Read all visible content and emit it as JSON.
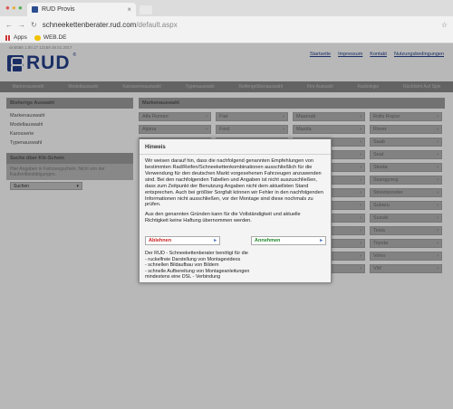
{
  "browser": {
    "tab_title": "RUD Provis",
    "url_domain": "schneekettenberater.rud.com",
    "url_path": "/default.aspx",
    "bookmarks": [
      "Apps",
      "WEB.DE"
    ]
  },
  "header": {
    "version": "vin0056 1.00.17 12159 26.01.2017",
    "logo_text": "RUD",
    "logo_reg": "®",
    "links": [
      "Startseite",
      "Impressum",
      "Kontakt",
      "Nutzungsbedingungen"
    ]
  },
  "nav": {
    "items": [
      "Markenauswahl",
      "Modellauswahl",
      "Karosserieauswahl",
      "Typenauswahl",
      "Reifengrößenauswahl",
      "Ihre Auswahl",
      "Radiologie",
      "Rückfahrt Auf Spin"
    ]
  },
  "left": {
    "head1": "Bisherige Auswahl",
    "links": [
      "Markenauswahl",
      "Modellauswahl",
      "Karosserie",
      "Typenauswahl"
    ],
    "head2": "Suche über Kfz-Schein",
    "hint": "Hier Angaben in Fahrzeugschein. Nicht von der Kaufzeitbestätigungen.",
    "search_label": "Suchen"
  },
  "right": {
    "head": "Markenauswahl",
    "brands": [
      "Alfa Romeo",
      "Fiat",
      "Maserati",
      "Rolls Royce",
      "Alpina",
      "Ford",
      "Mazda",
      "Rover",
      "",
      "",
      "",
      "Saab",
      "",
      "",
      "",
      "Seat",
      "",
      "",
      "",
      "Skoda",
      "",
      "",
      "",
      "Ssangyong",
      "",
      "",
      "",
      "Streetscooter",
      "",
      "",
      "",
      "Subaru",
      "",
      "",
      "",
      "Suzuki",
      "",
      "",
      "",
      "Tesla",
      "",
      "",
      "",
      "Toyota",
      "",
      "",
      "",
      "Volvo",
      "",
      "",
      "",
      "VW"
    ]
  },
  "modal": {
    "title": "Hinweis",
    "para1": "Wir weisen darauf hin, dass die nachfolgend genannten Empfehlungen von bestimmten Rad/Reifen/Schneekettenkombinationen ausschließlich für die Verwendung für den deutschen Markt vorgesehenen Fahrzeugen anzuwenden sind. Bei den nachfolgenden Tabellen und Angaben ist nicht auszuschließen, dass zum Zeitpunkt der Benutzung Angaben nicht dem aktuellsten Stand entsprechen. Auch bei größter Sorgfalt können wir Fehler in den nachfolgenden Informationen nicht ausschließen, vor der Montage sind diese nochmals zu prüfen.",
    "para2": "Aus den genannten Gründen kann für die Vollständigkeit und aktuelle Richtigkeit keine Haftung übernommen werden.",
    "decline_label": "Ablehnen",
    "accept_label": "Annehmen",
    "arrow": "▸",
    "info": [
      "Der RUD - Schneekettenberater benötigt für die",
      "- ruckelfreie Darstellung von Montagevideos",
      "- schnellen Bildaufbau von Bildern",
      "- schnelle Aufbereitung von Montageanleitungen",
      "mindestens eine DSL - Verbindung"
    ]
  },
  "colors": {
    "brand": "#24418c",
    "decline": "#cc2222",
    "accept": "#22882a"
  }
}
